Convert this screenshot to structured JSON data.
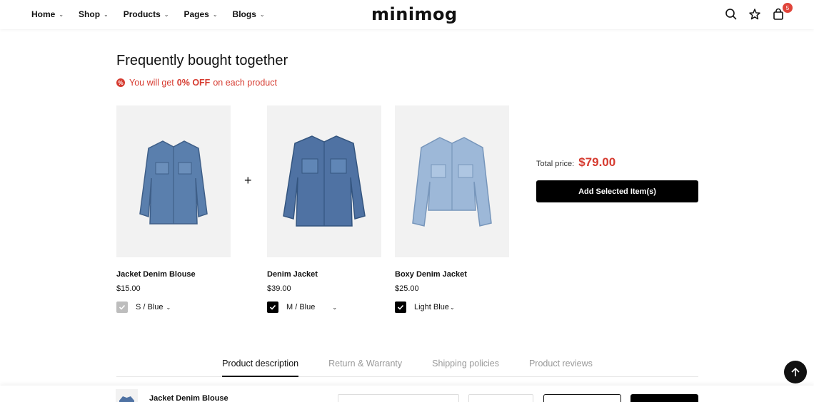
{
  "header": {
    "nav": [
      {
        "label": "Home",
        "name": "nav-home"
      },
      {
        "label": "Shop",
        "name": "nav-shop"
      },
      {
        "label": "Products",
        "name": "nav-products"
      },
      {
        "label": "Pages",
        "name": "nav-pages"
      },
      {
        "label": "Blogs",
        "name": "nav-blogs"
      }
    ],
    "logo": "minimog",
    "cart_count": "5"
  },
  "fbt": {
    "title": "Frequently bought together",
    "discount_prefix": "You will get",
    "discount_value": "0% OFF",
    "discount_suffix": "on each product",
    "plus_symbol": "+",
    "products": [
      {
        "name": "Jacket Denim Blouse",
        "price": "$15.00",
        "variant": "S / Blue",
        "checked": true,
        "disabled": true
      },
      {
        "name": "Denim Jacket",
        "price": "$39.00",
        "variant": "M / Blue",
        "checked": true,
        "disabled": false
      },
      {
        "name": "Boxy Denim Jacket",
        "price": "$25.00",
        "variant": "Light Blue",
        "checked": true,
        "disabled": false
      }
    ],
    "total_label": "Total price:",
    "total_value": "$79.00",
    "add_button": "Add Selected Item(s)"
  },
  "tabs": [
    {
      "label": "Product description",
      "active": true
    },
    {
      "label": "Return & Warranty",
      "active": false
    },
    {
      "label": "Shipping policies",
      "active": false
    },
    {
      "label": "Product reviews",
      "active": false
    }
  ],
  "sticky": {
    "product_name": "Jacket Denim Blouse"
  },
  "colors": {
    "accent_red": "#d63b30",
    "primary_black": "#000000",
    "image_bg": "#f2f2f2"
  }
}
